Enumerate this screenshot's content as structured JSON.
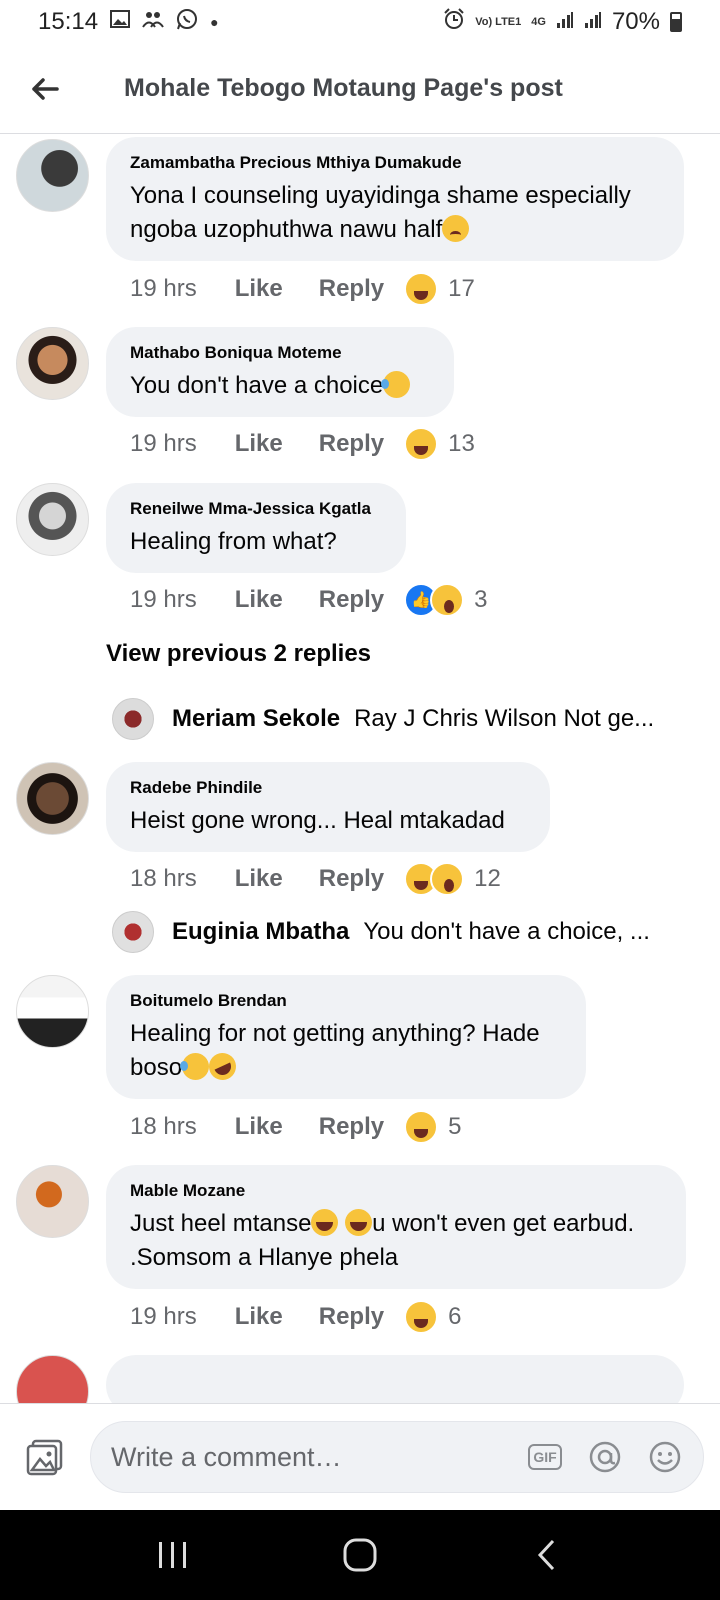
{
  "status_bar": {
    "time": "15:14",
    "network": "Vo) LTE1",
    "network_type": "4G",
    "battery": "70%"
  },
  "header": {
    "title": "Mohale Tebogo Motaung Page's post"
  },
  "comments": [
    {
      "name": "Zamambatha Precious Mthiya Dumakude",
      "text": "Yona I counseling uyayidinga shame especially ngoba uzophuthwa nawu half",
      "emojis": [
        "sad"
      ],
      "time": "19 hrs",
      "like_label": "Like",
      "reply_label": "Reply",
      "reactions": [
        "haha"
      ],
      "reaction_count": "17"
    },
    {
      "name": "Mathabo Boniqua Moteme",
      "text": "You don't have a choice",
      "emojis": [
        "laugh-tears"
      ],
      "time": "19 hrs",
      "like_label": "Like",
      "reply_label": "Reply",
      "reactions": [
        "haha"
      ],
      "reaction_count": "13"
    },
    {
      "name": "Reneilwe Mma-Jessica Kgatla",
      "text": "Healing from what?",
      "emojis": [],
      "time": "19 hrs",
      "like_label": "Like",
      "reply_label": "Reply",
      "reactions": [
        "like",
        "wow"
      ],
      "reaction_count": "3"
    },
    {
      "name": "Radebe Phindile",
      "text": "Heist gone wrong... Heal mtakadad",
      "emojis": [],
      "time": "18 hrs",
      "like_label": "Like",
      "reply_label": "Reply",
      "reactions": [
        "haha",
        "wow"
      ],
      "reaction_count": "12"
    },
    {
      "name": "Boitumelo Brendan",
      "text": "Healing for not getting anything? Hade boso",
      "emojis": [
        "laugh-tears",
        "rofl"
      ],
      "time": "18 hrs",
      "like_label": "Like",
      "reply_label": "Reply",
      "reactions": [
        "haha"
      ],
      "reaction_count": "5"
    },
    {
      "name": "Mable Mozane",
      "text_part1": "Just heel mtanse",
      "text_part2": "u won't even get earbud. .Somsom a Hlanye phela",
      "emojis": [
        "grin",
        "grin"
      ],
      "time": "19 hrs",
      "like_label": "Like",
      "reply_label": "Reply",
      "reactions": [
        "haha"
      ],
      "reaction_count": "6"
    }
  ],
  "view_previous": "View previous 2 replies",
  "reply_previews": [
    {
      "name": "Meriam Sekole",
      "text": "Ray J Chris Wilson Not ge..."
    },
    {
      "name": "Euginia Mbatha",
      "text": "You don't have a choice, ..."
    }
  ],
  "composer": {
    "placeholder": "Write a comment…",
    "gif_label": "GIF"
  }
}
